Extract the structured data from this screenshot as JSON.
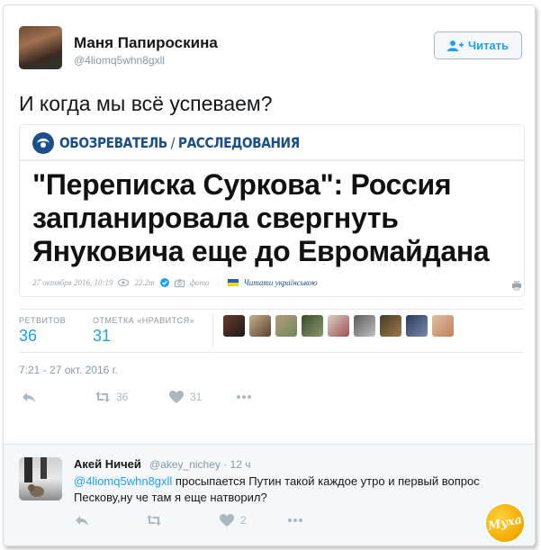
{
  "tweet": {
    "author_name": "Маня Папироскина",
    "author_handle": "@4liomq5whn8gxll",
    "follow_label": "Читать",
    "text": "И когда мы всё успеваем?",
    "time": "7:21 - 27 окт. 2016 г.",
    "retweets_label": "РЕТВИТОВ",
    "retweets_count": "36",
    "likes_label": "ОТМЕТКА «НРАВИТСЯ»",
    "likes_count": "31",
    "action_retweet_count": "36",
    "action_like_count": "31"
  },
  "media": {
    "brand": "ОБОЗРЕВАТЕЛЬ",
    "brand_sep": " / ",
    "section": "РАССЛЕДОВАНИЯ",
    "headline": "\"Переписка Суркова\": Россия запланировала свергнуть Януковича еще до Евромайдана",
    "date": "27 октября 2016, 10:19",
    "views": "22.2т",
    "photo_label": "фото",
    "ukr_link": "Читати українською"
  },
  "reply": {
    "author_name": "Акей Ничей",
    "author_handle": "@akey_nichey · 12 ч",
    "mention": "@4liomq5whn8gxll",
    "text": " просыпается Путин такой каждое утро и первый вопрос Пескову,ну че там я еще натворил?",
    "like_count": "2"
  },
  "watermark": "Муха",
  "colors": {
    "accent": "#1da1f2",
    "muted": "#8899a6",
    "brand_blue": "#1a4f8c"
  }
}
